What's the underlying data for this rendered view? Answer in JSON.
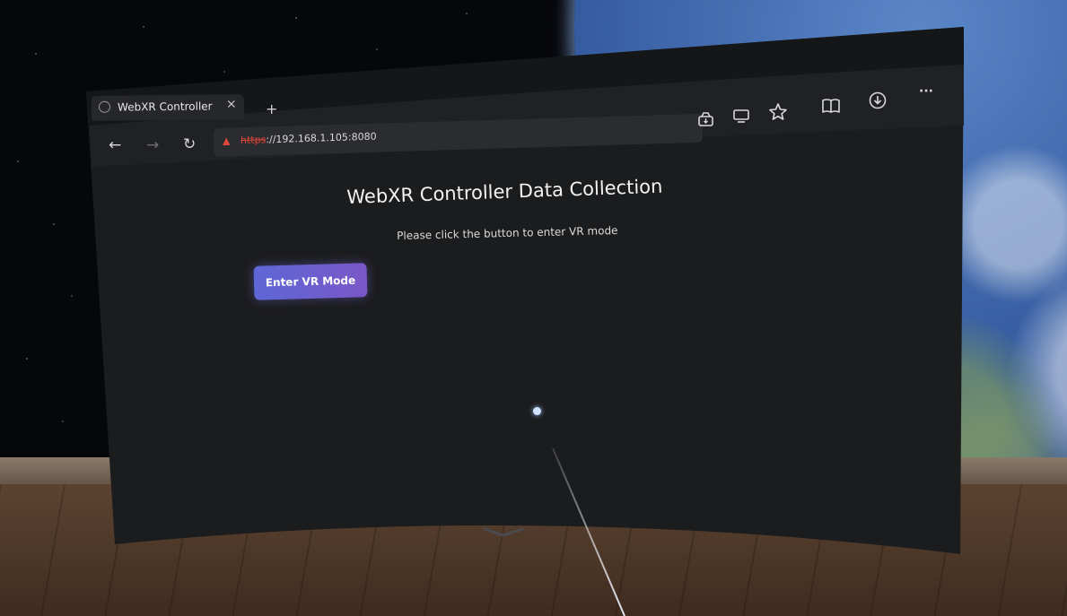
{
  "browser": {
    "tab": {
      "title": "WebXR Controller Da",
      "close_glyph": "×",
      "favicon_icon": "globe-icon"
    },
    "new_tab_glyph": "+",
    "nav": {
      "back_glyph": "←",
      "forward_glyph": "→",
      "reload_glyph": "↻"
    },
    "address_bar": {
      "warning_glyph": "▲",
      "protocol": "https",
      "rest": "://192.168.1.105:8080"
    },
    "toolbar_icons": [
      "install-app-icon",
      "cast-screen-icon",
      "favorite-star-icon",
      "reading-mode-icon",
      "download-icon",
      "more-options-icon"
    ],
    "more_glyph": "···"
  },
  "page": {
    "title": "WebXR Controller Data Collection",
    "subtitle": "Please click the button to enter VR mode",
    "vr_button_label": "Enter VR Mode"
  },
  "colors": {
    "panel": "#1b1c1e",
    "toolbar": "#202124",
    "button_start": "#5e67d6",
    "button_end": "#7a57c7",
    "warning": "#e0463c"
  }
}
